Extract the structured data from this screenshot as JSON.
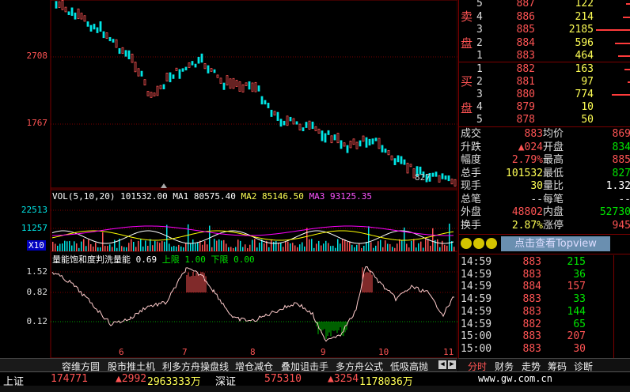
{
  "main_chart": {
    "y_labels": [
      "2708",
      "1767"
    ],
    "price_note": "827"
  },
  "volume_legend": {
    "vol": "VOL(5,10,20)",
    "v1": "101532.00",
    "ma1": "MA1 80575.40",
    "ma2": "MA2 85146.50",
    "ma3": "MA3 93125.35"
  },
  "volume_axis": [
    "22513",
    "11257",
    "X10"
  ],
  "indicator_legend": {
    "name": "量能饱和度判洗量能",
    "value": "0.69",
    "upper": "上限 1.00",
    "lower": "下限 0.00"
  },
  "indicator_axis": [
    "1.52",
    "0.82",
    "0.12"
  ],
  "x_ticks": [
    "6",
    "7",
    "8",
    "9",
    "10",
    "11"
  ],
  "order_book": {
    "sell_label": [
      "卖",
      "盘"
    ],
    "buy_label": [
      "买",
      "盘"
    ],
    "sells": [
      {
        "lvl": "5",
        "price": "887",
        "vol": "122"
      },
      {
        "lvl": "4",
        "price": "886",
        "vol": "214"
      },
      {
        "lvl": "3",
        "price": "885",
        "vol": "2185"
      },
      {
        "lvl": "2",
        "price": "884",
        "vol": "596"
      },
      {
        "lvl": "1",
        "price": "883",
        "vol": "464"
      }
    ],
    "buys": [
      {
        "lvl": "1",
        "price": "882",
        "vol": "163"
      },
      {
        "lvl": "2",
        "price": "881",
        "vol": "97"
      },
      {
        "lvl": "3",
        "price": "880",
        "vol": "774"
      },
      {
        "lvl": "4",
        "price": "879",
        "vol": "10"
      },
      {
        "lvl": "5",
        "price": "878",
        "vol": "50"
      }
    ]
  },
  "stats": [
    {
      "l1": "成交",
      "v1": "883",
      "l2": "均价",
      "v2": "869"
    },
    {
      "l1": "升跌",
      "v1": "▲024",
      "l2": "开盘",
      "v2": "834"
    },
    {
      "l1": "幅度",
      "v1": "2.79%",
      "l2": "最高",
      "v2": "885"
    },
    {
      "l1": "总手",
      "v1": "101532",
      "l2": "最低",
      "v2": "827"
    },
    {
      "l1": "现手",
      "v1": "30",
      "l2": "量比",
      "v2": "1.32"
    },
    {
      "l1": "总笔",
      "v1": "--",
      "l2": "每笔",
      "v2": "--"
    },
    {
      "l1": "外盘",
      "v1": "48802",
      "l2": "内盘",
      "v2": "52730"
    },
    {
      "l1": "换手",
      "v1": "2.87%",
      "l2": "涨停",
      "v2": "945"
    }
  ],
  "topview_button": "点击查看Topview",
  "trades": [
    {
      "t": "14:59",
      "p": "883",
      "v": "215",
      "c": "grn"
    },
    {
      "t": "14:59",
      "p": "883",
      "v": "36",
      "c": "grn"
    },
    {
      "t": "14:59",
      "p": "884",
      "v": "157",
      "c": "red"
    },
    {
      "t": "14:59",
      "p": "883",
      "v": "33",
      "c": "grn"
    },
    {
      "t": "14:59",
      "p": "883",
      "v": "144",
      "c": "grn"
    },
    {
      "t": "14:59",
      "p": "882",
      "v": "65",
      "c": "grn"
    },
    {
      "t": "15:00",
      "p": "883",
      "v": "207",
      "c": "red"
    },
    {
      "t": "15:00",
      "p": "883",
      "v": "30",
      "c": "red"
    }
  ],
  "bottom_tabs": [
    "容维方圆",
    "股市推土机",
    "利多方舟操盘线",
    "增仓减仓",
    "叠加诅击手",
    "多方舟公式",
    "低吸高抛"
  ],
  "right_tabs": [
    "分时",
    "财务",
    "走势",
    "筹码",
    "诊断"
  ],
  "status": {
    "idx1": "上证",
    "val1": "174771",
    "chg1": "▲2992",
    "amt1": "2963333万",
    "idx2": "深证",
    "val2": "575310",
    "chg2": "▲3254",
    "amt2": "1178036万",
    "url": "www.gw.com.cn"
  }
}
